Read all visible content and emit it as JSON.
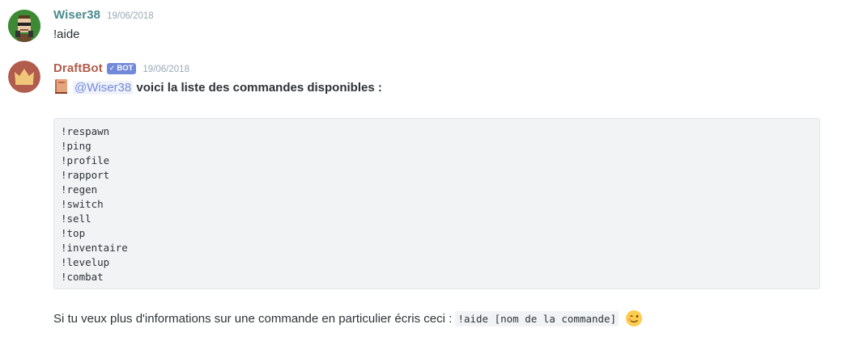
{
  "messages": [
    {
      "username": "Wiser38",
      "username_color": "#4b8a8e",
      "timestamp": "19/06/2018",
      "text": "!aide"
    },
    {
      "username": "DraftBot",
      "username_color": "#b15c4c",
      "bot_tag": "BOT",
      "timestamp": "19/06/2018",
      "intro_icon": "book-icon",
      "mention": "@Wiser38",
      "intro_text": "voici la liste des commandes disponibles :",
      "commands": [
        "!respawn",
        "!ping",
        "!profile",
        "!rapport",
        "!regen",
        "!switch",
        "!sell",
        "!top",
        "!inventaire",
        "!levelup",
        "!combat"
      ],
      "footer_text": "Si tu veux plus d'informations sur une commande en particulier écris ceci :",
      "footer_code": "!aide [nom de la commande]",
      "footer_emoji": "winking-face-emoji"
    }
  ],
  "colors": {
    "bot_tag": "#7289da",
    "mention": "#7289da",
    "code_bg": "#f2f3f5"
  }
}
